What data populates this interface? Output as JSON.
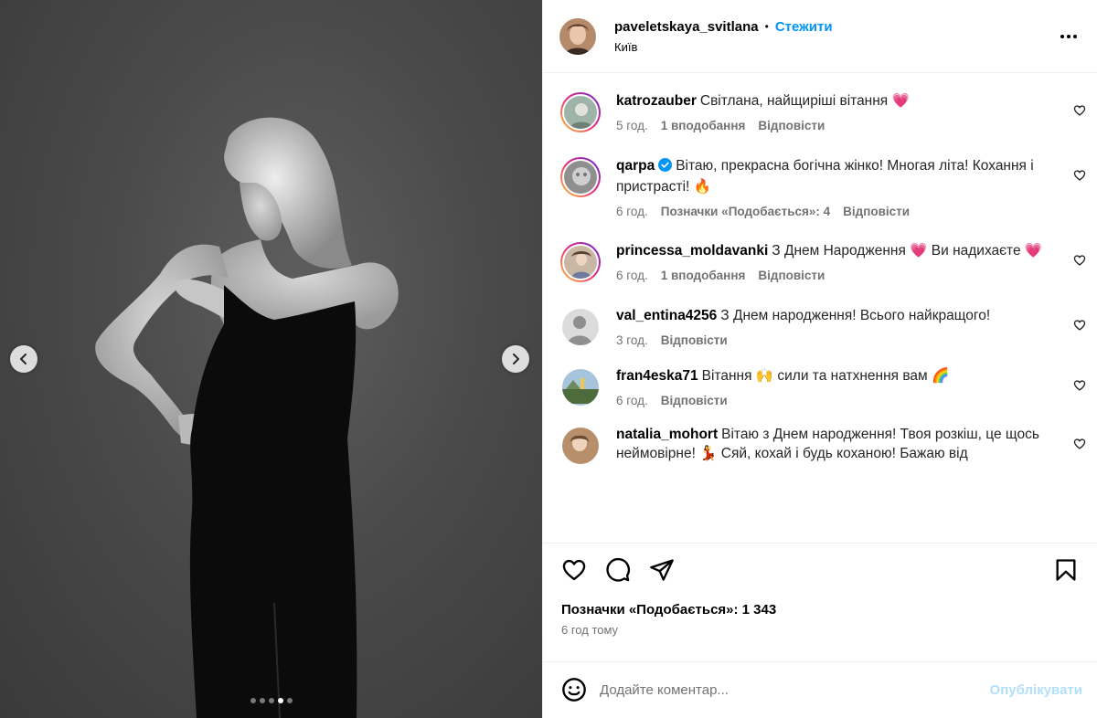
{
  "post": {
    "author": "paveletskaya_svitlana",
    "separator": "•",
    "follow_label": "Стежити",
    "location": "Київ",
    "photo_count": 5,
    "active_photo_index": 3
  },
  "comments": [
    {
      "user": "katrozauber",
      "verified": false,
      "text": "Світлана, найщиріші вітання 💗",
      "time": "5 год.",
      "likes": "1 вподобання",
      "reply": "Відповісти",
      "story_ring": true
    },
    {
      "user": "qarpa",
      "verified": true,
      "text": "Вітаю, прекрасна богічна жінко! Многая літа! Кохання і пристрасті! 🔥",
      "time": "6 год.",
      "likes": "Позначки «Подобається»: 4",
      "reply": "Відповісти",
      "story_ring": true
    },
    {
      "user": "princessa_moldavanki",
      "verified": false,
      "text": "З Днем Народження 💗 Ви надихаєте 💗",
      "time": "6 год.",
      "likes": "1 вподобання",
      "reply": "Відповісти",
      "story_ring": true
    },
    {
      "user": "val_entina4256",
      "verified": false,
      "text": "З Днем народження! Всього найкращого!",
      "time": "3 год.",
      "likes": "",
      "reply": "Відповісти",
      "story_ring": false
    },
    {
      "user": "fran4eska71",
      "verified": false,
      "text": "Вітання 🙌 сили та натхнення вам 🌈",
      "time": "6 год.",
      "likes": "",
      "reply": "Відповісти",
      "story_ring": false
    },
    {
      "user": "natalia_mohort",
      "verified": false,
      "text": "Вітаю з Днем народження! Твоя розкіш, це щось неймовірне! 💃 Сяй, кохай і будь коханою! Бажаю від",
      "time": "",
      "likes": "",
      "reply": "",
      "story_ring": false
    }
  ],
  "footer": {
    "likes_text": "Позначки «Подобається»: 1 343",
    "time_ago": "6 год тому",
    "comment_placeholder": "Додайте коментар...",
    "publish_label": "Опублікувати"
  },
  "colors": {
    "accent": "#0095f6",
    "publish_disabled": "#b2dffc",
    "meta_text": "#737373",
    "divider": "#efefef"
  },
  "icons": {
    "nav_prev": "chevron-left-icon",
    "nav_next": "chevron-right-icon",
    "more": "more-options-icon",
    "like": "heart-icon",
    "comment": "comment-icon",
    "share": "share-icon",
    "save": "bookmark-icon",
    "emoji": "emoji-icon",
    "verified": "verified-badge-icon"
  }
}
